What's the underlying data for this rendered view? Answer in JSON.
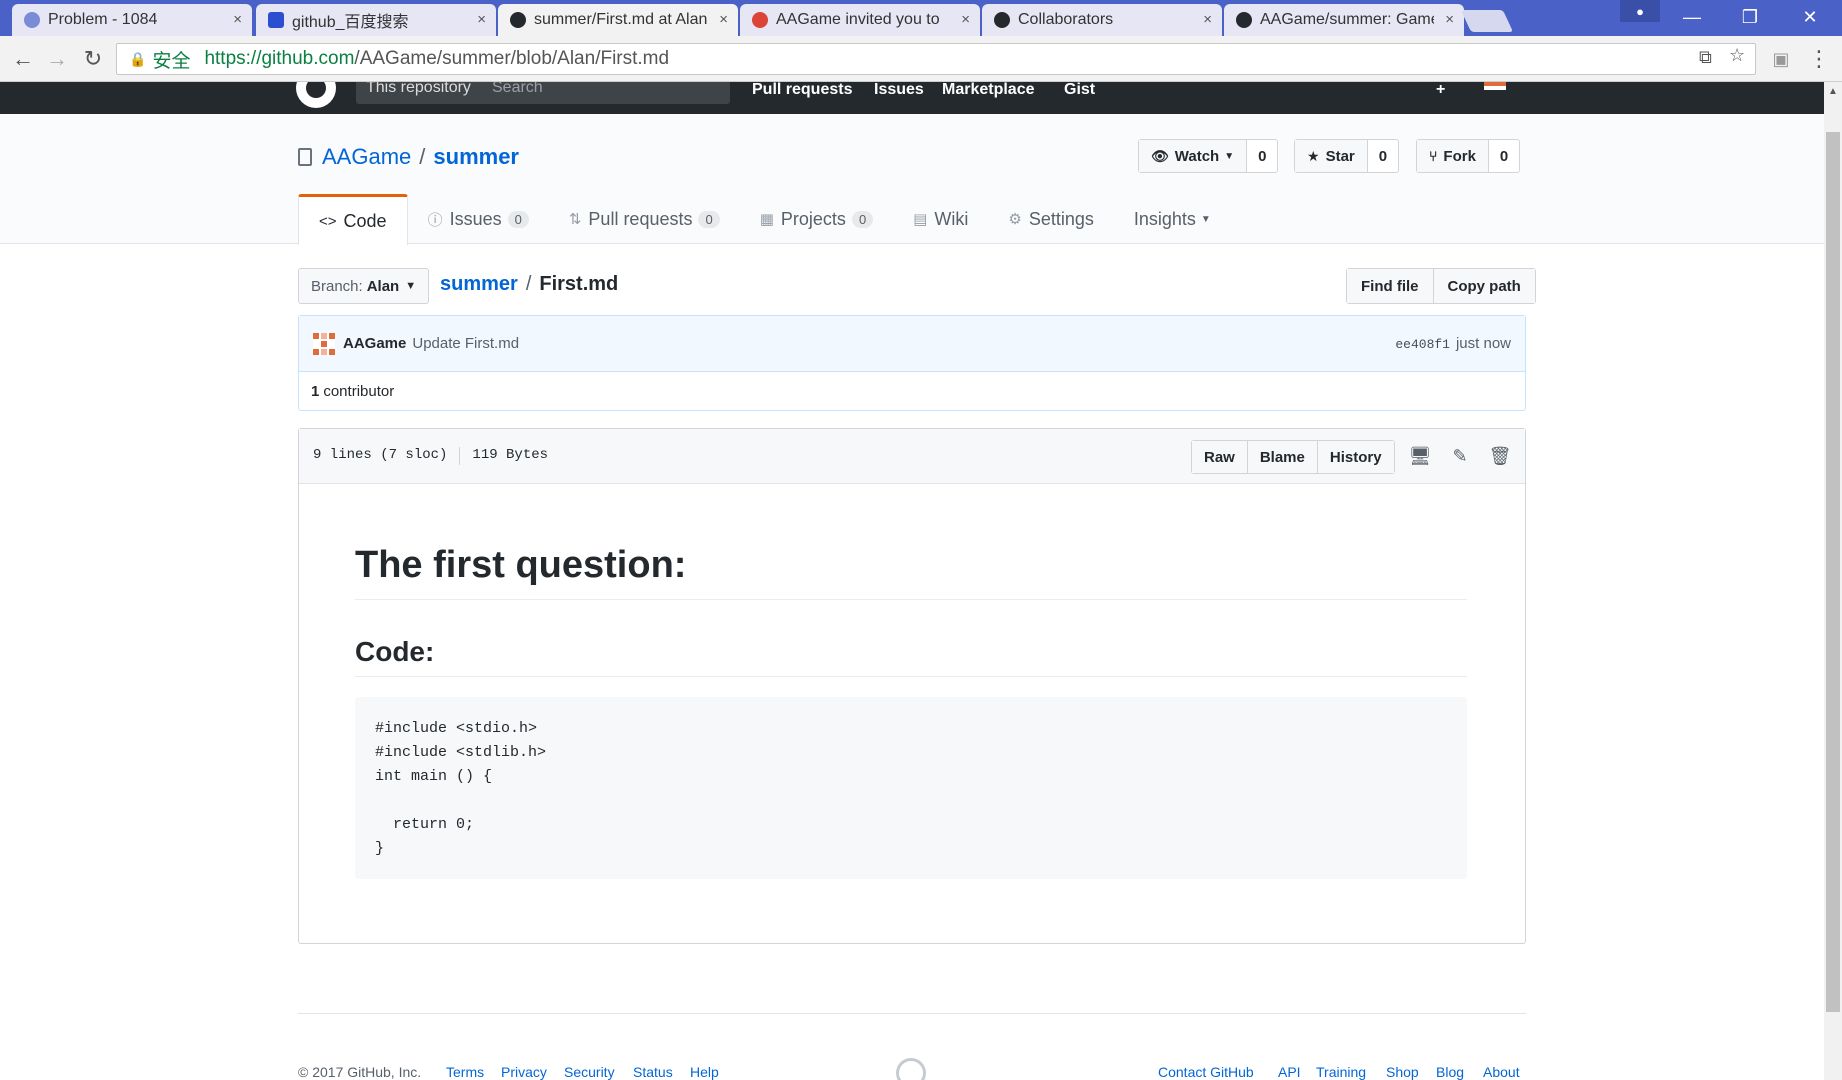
{
  "browser": {
    "tabs": [
      {
        "title": "Problem - 1084",
        "icon_color": "#7b8bd8"
      },
      {
        "title": "github_百度搜索",
        "icon_color": "#2b4fcf"
      },
      {
        "title": "summer/First.md at Alan",
        "icon_color": "#24292e"
      },
      {
        "title": "AAGame invited you to",
        "icon_color": "#db4437"
      },
      {
        "title": "Collaborators",
        "icon_color": "#24292e"
      },
      {
        "title": "AAGame/summer: Game",
        "icon_color": "#24292e"
      }
    ],
    "close_glyph": "×",
    "secure_label": "安全",
    "url_host": "https://github.com",
    "url_path": "/AAGame/summer/blob/Alan/First.md",
    "window_controls": {
      "minimize": "—",
      "restore": "❐",
      "close": "✕"
    }
  },
  "gh_header": {
    "scope_label": "This repository",
    "search_placeholder": "Search",
    "nav": [
      "Pull requests",
      "Issues",
      "Marketplace",
      "Gist"
    ],
    "plus": "+"
  },
  "repo": {
    "owner": "AAGame",
    "separator": "/",
    "name": "summer",
    "watch": {
      "label": "Watch",
      "count": "0"
    },
    "star": {
      "label": "Star",
      "count": "0"
    },
    "fork": {
      "label": "Fork",
      "count": "0"
    },
    "tabs": {
      "code": "Code",
      "issues": "Issues",
      "issues_count": "0",
      "pulls": "Pull requests",
      "pulls_count": "0",
      "projects": "Projects",
      "projects_count": "0",
      "wiki": "Wiki",
      "settings": "Settings",
      "insights": "Insights"
    }
  },
  "file_nav": {
    "branch_prefix": "Branch:",
    "branch": "Alan",
    "root": "summer",
    "sep": "/",
    "file": "First.md",
    "find_file": "Find file",
    "copy_path": "Copy path"
  },
  "commit": {
    "author": "AAGame",
    "message": "Update First.md",
    "sha": "ee408f1",
    "time": "just now",
    "contributors_count": "1",
    "contributors_label": "contributor"
  },
  "file": {
    "lines": "9 lines (7 sloc)",
    "size": "119 Bytes",
    "raw": "Raw",
    "blame": "Blame",
    "history": "History"
  },
  "markdown": {
    "h1": "The first question:",
    "h2": "Code:",
    "code": "#include <stdio.h>\n#include <stdlib.h>\nint main () {\n\n  return 0;\n}"
  },
  "footer": {
    "copyright": "© 2017 GitHub, Inc.",
    "left_links": [
      "Terms",
      "Privacy",
      "Security",
      "Status",
      "Help"
    ],
    "right_links": [
      "Contact GitHub",
      "API",
      "Training",
      "Shop",
      "Blog",
      "About"
    ]
  },
  "colors": {
    "link": "#0366d6",
    "accent_tab": "#e36209",
    "secure_green": "#0b8043",
    "header_dark": "#24292e"
  }
}
